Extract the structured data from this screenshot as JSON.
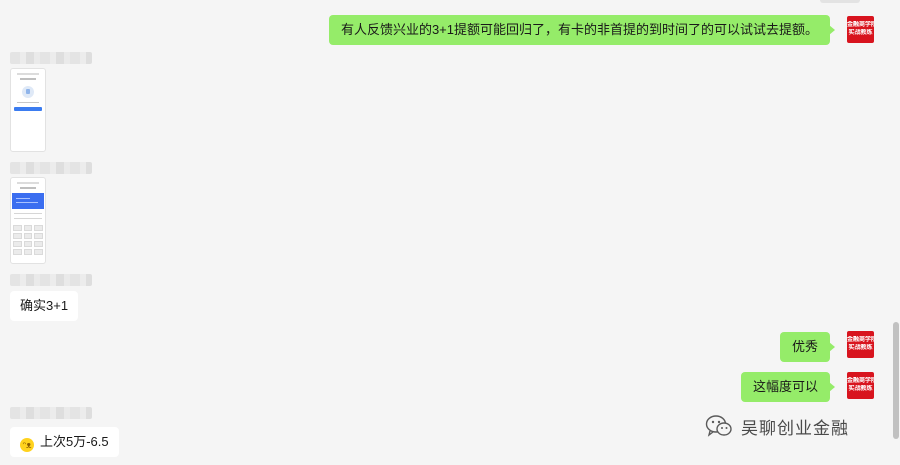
{
  "messages": {
    "out1": {
      "text": "有人反馈兴业的3+1提额可能回归了，有卡的非首提的到时间了的可以试试去提额。"
    },
    "in_text1": {
      "text": "确实3+1"
    },
    "out2": {
      "text": "优秀"
    },
    "out3": {
      "text": "这幅度可以"
    },
    "in_text2": {
      "text": "上次5万-6.5"
    }
  },
  "avatar": {
    "line1": "金融商学院",
    "line2": "实战教练"
  },
  "watermark": {
    "text": "吴聊创业金融"
  },
  "colors": {
    "outgoing_bubble": "#95ec69",
    "incoming_bubble": "#ffffff",
    "background": "#f5f5f5",
    "avatar": "#d8141e"
  },
  "icons": {
    "emoji": "laughing-emoji-icon",
    "watermark": "wechat-icon"
  }
}
